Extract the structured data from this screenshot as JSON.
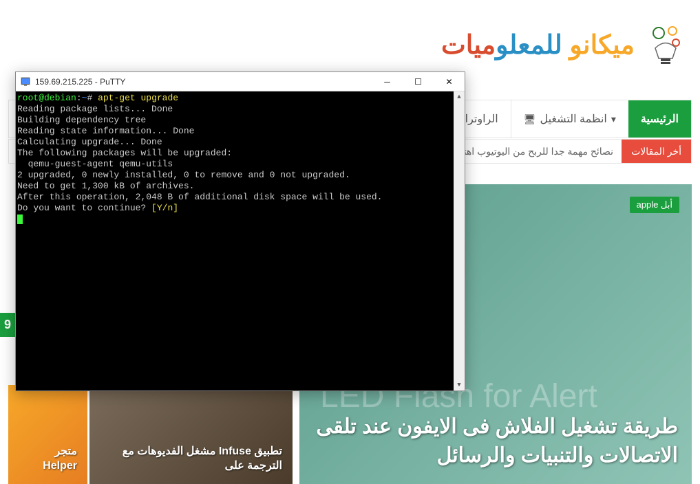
{
  "website": {
    "logo_words": [
      "ميكانو",
      " ",
      "للمعلو",
      "ميات"
    ],
    "nav": {
      "home": "الرئيسية",
      "os": "انظمة التشغيل",
      "routers": "الراوترات"
    },
    "ticker": {
      "label": "أخر المقالات",
      "content": "نصائح مهمة جدا للربح من اليوتيوب اهتم بها"
    },
    "main_article": {
      "badge": "أبل apple",
      "led_text": "LED Flash for Alert",
      "title": "طريقة تشغيل الفلاش فى الايفون عند تلقى الاتصالات والتنبيات والرسائل"
    },
    "card1": {
      "title": "تطبيق Infuse مشغل الفديوهات مع الترجمة على"
    },
    "card2": {
      "title": "متجر Helper"
    },
    "left_marker": "9"
  },
  "putty": {
    "title": "159.69.215.225 - PuTTY",
    "prompt_user": "root@debian",
    "prompt_sep": ":",
    "prompt_path": "~",
    "prompt_end": "# ",
    "command": "apt-get upgrade",
    "lines": [
      "Reading package lists... Done",
      "Building dependency tree",
      "Reading state information... Done",
      "Calculating upgrade... Done",
      "The following packages will be upgraded:",
      "  qemu-guest-agent qemu-utils",
      "2 upgraded, 0 newly installed, 0 to remove and 0 not upgraded.",
      "Need to get 1,300 kB of archives.",
      "After this operation, 2,048 B of additional disk space will be used."
    ],
    "continue_prompt": "Do you want to continue? ",
    "continue_yn": "[Y/n]"
  }
}
